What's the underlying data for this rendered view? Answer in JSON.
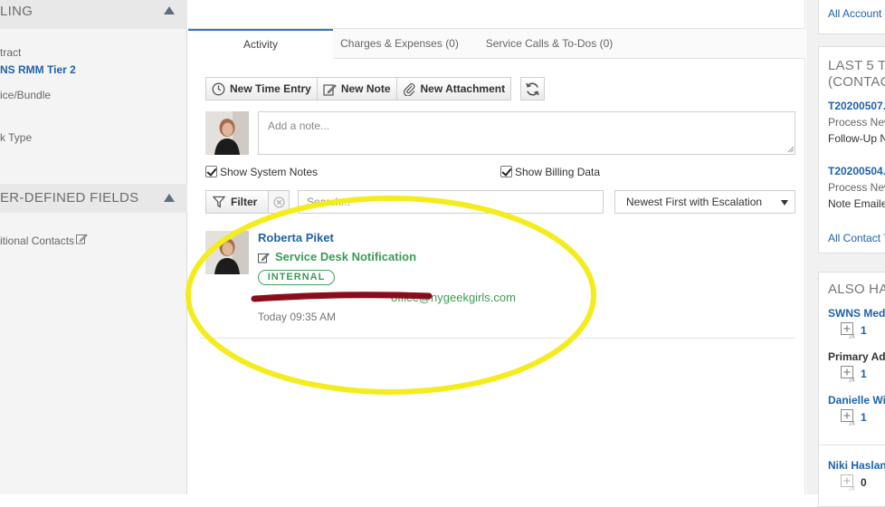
{
  "left_panel": {
    "billing_header": "LING",
    "contract_label": "tract",
    "contract_value": "NS RMM Tier 2",
    "service_bundle_label": "ice/Bundle",
    "work_type_label": "k Type",
    "udf_header": "ER-DEFINED FIELDS",
    "additional_contacts_label": "itional Contacts"
  },
  "tabs": [
    {
      "label": "Activity",
      "active": true
    },
    {
      "label": "Charges & Expenses (0)",
      "active": false
    },
    {
      "label": "Service Calls & To-Dos (0)",
      "active": false
    }
  ],
  "toolbar": {
    "new_time_entry": "New Time Entry",
    "new_note": "New Note",
    "new_attachment": "New Attachment"
  },
  "note_input": {
    "placeholder": "Add a note..."
  },
  "options": {
    "show_system_notes": "Show System Notes",
    "show_billing_data": "Show Billing Data"
  },
  "filter": {
    "label": "Filter",
    "search_placeholder": "Search...",
    "sort_value": "Newest First with Escalation"
  },
  "activity_item": {
    "author": "Roberta Piket",
    "title": "Service Desk Notification",
    "badge": "INTERNAL",
    "email_visible": "office@nygeekgirls.com",
    "time": "Today 09:35 AM"
  },
  "right_panel": {
    "all_account_link": "All Account T",
    "last5_header_line1": "LAST 5 T",
    "last5_header_line2": "(CONTAC",
    "tickets": [
      {
        "number": "T20200507.",
        "line1": "Process New",
        "line2": "Follow-Up N"
      },
      {
        "number": "T20200504.",
        "line1": "Process New",
        "line2": "Note Emailed"
      }
    ],
    "all_contact_link": "All Contact T",
    "also_header": "ALSO HA",
    "contacts": [
      {
        "name": "SWNS Med",
        "count": "1",
        "link": true
      },
      {
        "name": "Primary Ad",
        "count": "1",
        "link": false
      },
      {
        "name": "Danielle Wi",
        "count": "1",
        "link": true
      },
      {
        "name": "Niki Haslan",
        "count": "0",
        "link": true
      }
    ]
  },
  "colors": {
    "link_blue": "#1f62a8",
    "accent_green": "#3f9a58",
    "annotation_yellow": "#f4ec1c",
    "redaction_red": "#8b0d1c"
  }
}
